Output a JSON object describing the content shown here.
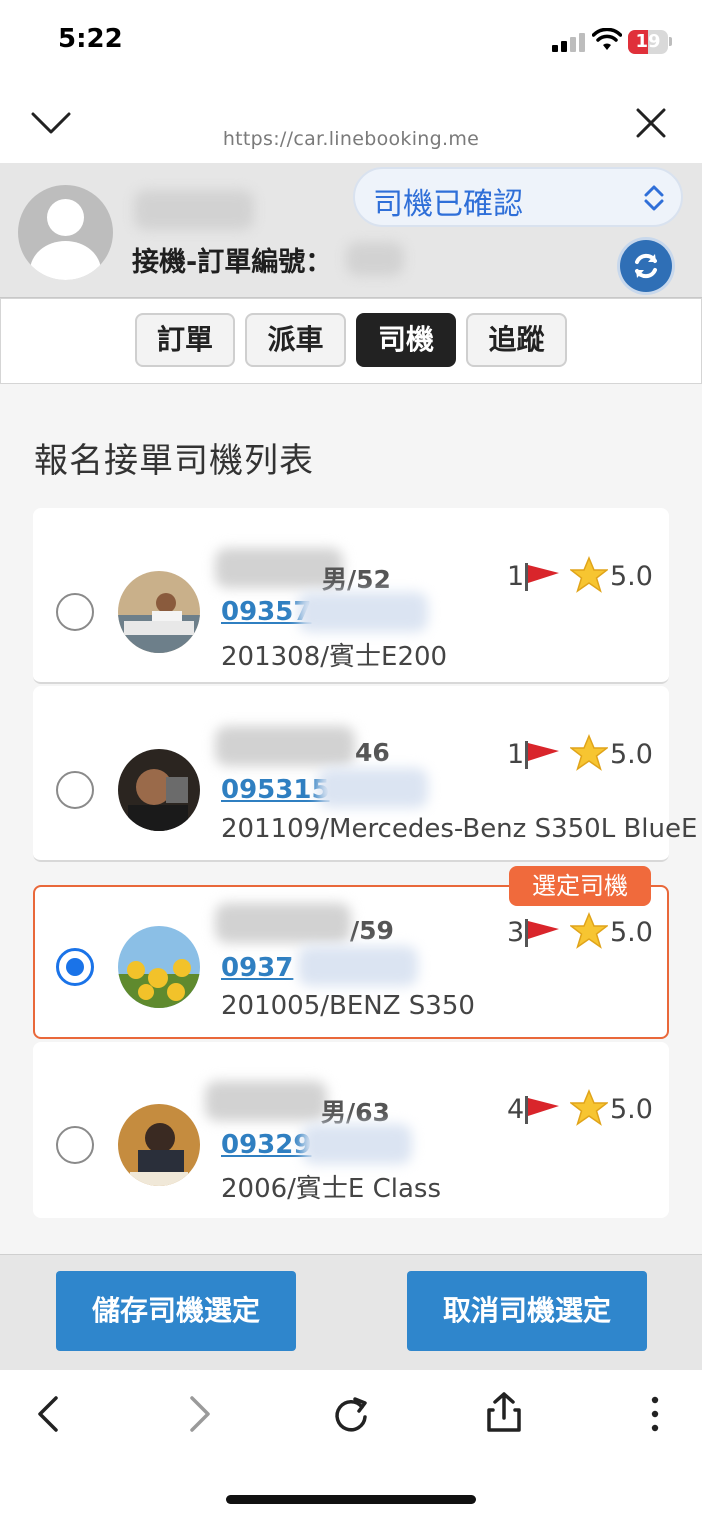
{
  "status_bar": {
    "time": "5:22",
    "battery": "19"
  },
  "browser": {
    "url": "https://car.linebooking.me"
  },
  "header": {
    "customer_name": "",
    "order_label": "接機-訂單編號：",
    "status_select": "司機已確認"
  },
  "tabs": [
    {
      "label": "訂單",
      "active": false
    },
    {
      "label": "派車",
      "active": false
    },
    {
      "label": "司機",
      "active": true
    },
    {
      "label": "追蹤",
      "active": false
    }
  ],
  "section_title": "報名接單司機列表",
  "drivers": [
    {
      "name": "男/52",
      "phone": "09357",
      "car": "201308/賓士E200",
      "count": "1",
      "rating": "5.0",
      "selected": false
    },
    {
      "name": "46",
      "phone": "095315",
      "car": "201109/Mercedes-Benz S350L BlueE",
      "count": "1",
      "rating": "5.0",
      "selected": false
    },
    {
      "name": "/59",
      "phone": "0937",
      "car": "201005/BENZ S350",
      "count": "3",
      "rating": "5.0",
      "selected": true
    },
    {
      "name": "男/63",
      "phone": "09329",
      "car": "2006/賓士E Class",
      "count": "4",
      "rating": "5.0",
      "selected": false
    }
  ],
  "selected_badge": "選定司機",
  "buttons": {
    "save": "儲存司機選定",
    "cancel": "取消司機選定"
  },
  "colors": {
    "accent_blue": "#2f86cc",
    "selected_orange": "#f06a3c",
    "link_blue": "#2f7fc1"
  },
  "icons": [
    "chevron-down-icon",
    "close-icon",
    "refresh-icon",
    "flag-icon",
    "star-icon",
    "back-icon",
    "forward-icon",
    "reload-icon",
    "share-icon",
    "more-icon"
  ]
}
